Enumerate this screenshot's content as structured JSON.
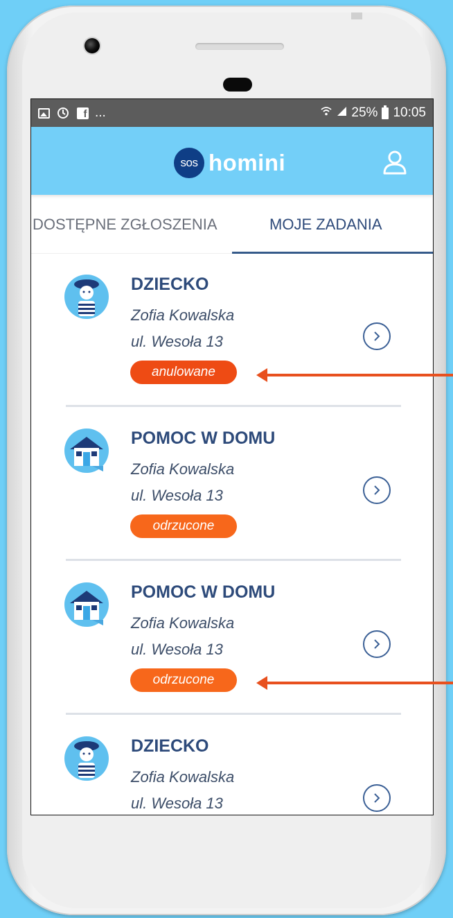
{
  "status_bar": {
    "left_icons": [
      "image-icon",
      "sync-icon",
      "facebook-icon"
    ],
    "more": "...",
    "battery": "25%",
    "time": "10:05"
  },
  "app": {
    "logo_badge": "sos",
    "logo_name": "homini"
  },
  "tabs": [
    {
      "label": "DOSTĘPNE ZGŁOSZENIA",
      "active": false
    },
    {
      "label": "MOJE ZADANIA",
      "active": true
    }
  ],
  "items": [
    {
      "category": "DZIECKO",
      "icon": "child-icon",
      "name": "Zofia Kowalska",
      "address": "ul. Wesoła 13",
      "status": "anulowane",
      "status_color": "#ee4b14"
    },
    {
      "category": "POMOC W DOMU",
      "icon": "house-icon",
      "name": "Zofia Kowalska",
      "address": "ul. Wesoła 13",
      "status": "odrzucone",
      "status_color": "#f7671b"
    },
    {
      "category": "POMOC W DOMU",
      "icon": "house-icon",
      "name": "Zofia Kowalska",
      "address": "ul. Wesoła 13",
      "status": "odrzucone",
      "status_color": "#f7671b"
    },
    {
      "category": "DZIECKO",
      "icon": "child-icon",
      "name": "Zofia Kowalska",
      "address": "ul. Wesoła 13",
      "status": "",
      "status_color": "#f7671b"
    }
  ],
  "colors": {
    "background": "#6fcff7",
    "appbar": "#73cff8",
    "accent": "#2d4a7a",
    "annotation_arrow": "#e8501e"
  }
}
